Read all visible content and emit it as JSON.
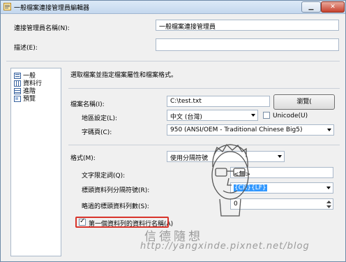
{
  "window": {
    "title": "一般檔案連接管理員編輯器"
  },
  "fields": {
    "manager_name_label": "連接管理員名稱(N):",
    "manager_name_value": "一般檔案連接管理員",
    "description_label": "描述(E):",
    "description_value": ""
  },
  "tree": {
    "items": [
      {
        "label": "一般",
        "icon": "general-icon"
      },
      {
        "label": "資料行",
        "icon": "columns-icon"
      },
      {
        "label": "進階",
        "icon": "advanced-icon"
      },
      {
        "label": "預覽",
        "icon": "preview-icon"
      }
    ]
  },
  "main": {
    "instruction": "選取檔案並指定檔案屬性和檔案格式。",
    "file_name_label": "檔案名稱(I):",
    "file_name_value": "C:\\test.txt",
    "browse_label": "瀏覽(",
    "locale_label": "地區設定(L):",
    "locale_value": "中文 (台灣)",
    "unicode_label": "Unicode(U)",
    "unicode_checked": false,
    "codepage_label": "字碼頁(C):",
    "codepage_value": "950   (ANSI/OEM - Traditional Chinese Big5)",
    "format_label": "格式(M):",
    "format_value": "使用分隔符號",
    "text_qualifier_label": "文字限定詞(Q):",
    "text_qualifier_value": "<無>",
    "header_delimiter_label": "標頭資料列分隔符號(R):",
    "header_delimiter_value": "{CR}{LF}",
    "header_skip_label": "略過的標頭資料列數(S):",
    "header_skip_value": "0",
    "first_row_names_label": "第一個資料列的資料行名稱(A)",
    "first_row_names_checked": true
  },
  "watermark": {
    "brand": "信德隨想",
    "url": "http://yangxinde.pixnet.net/blog"
  },
  "colors": {
    "highlight_border": "#d8332a",
    "selection_bg": "#3399ff"
  }
}
